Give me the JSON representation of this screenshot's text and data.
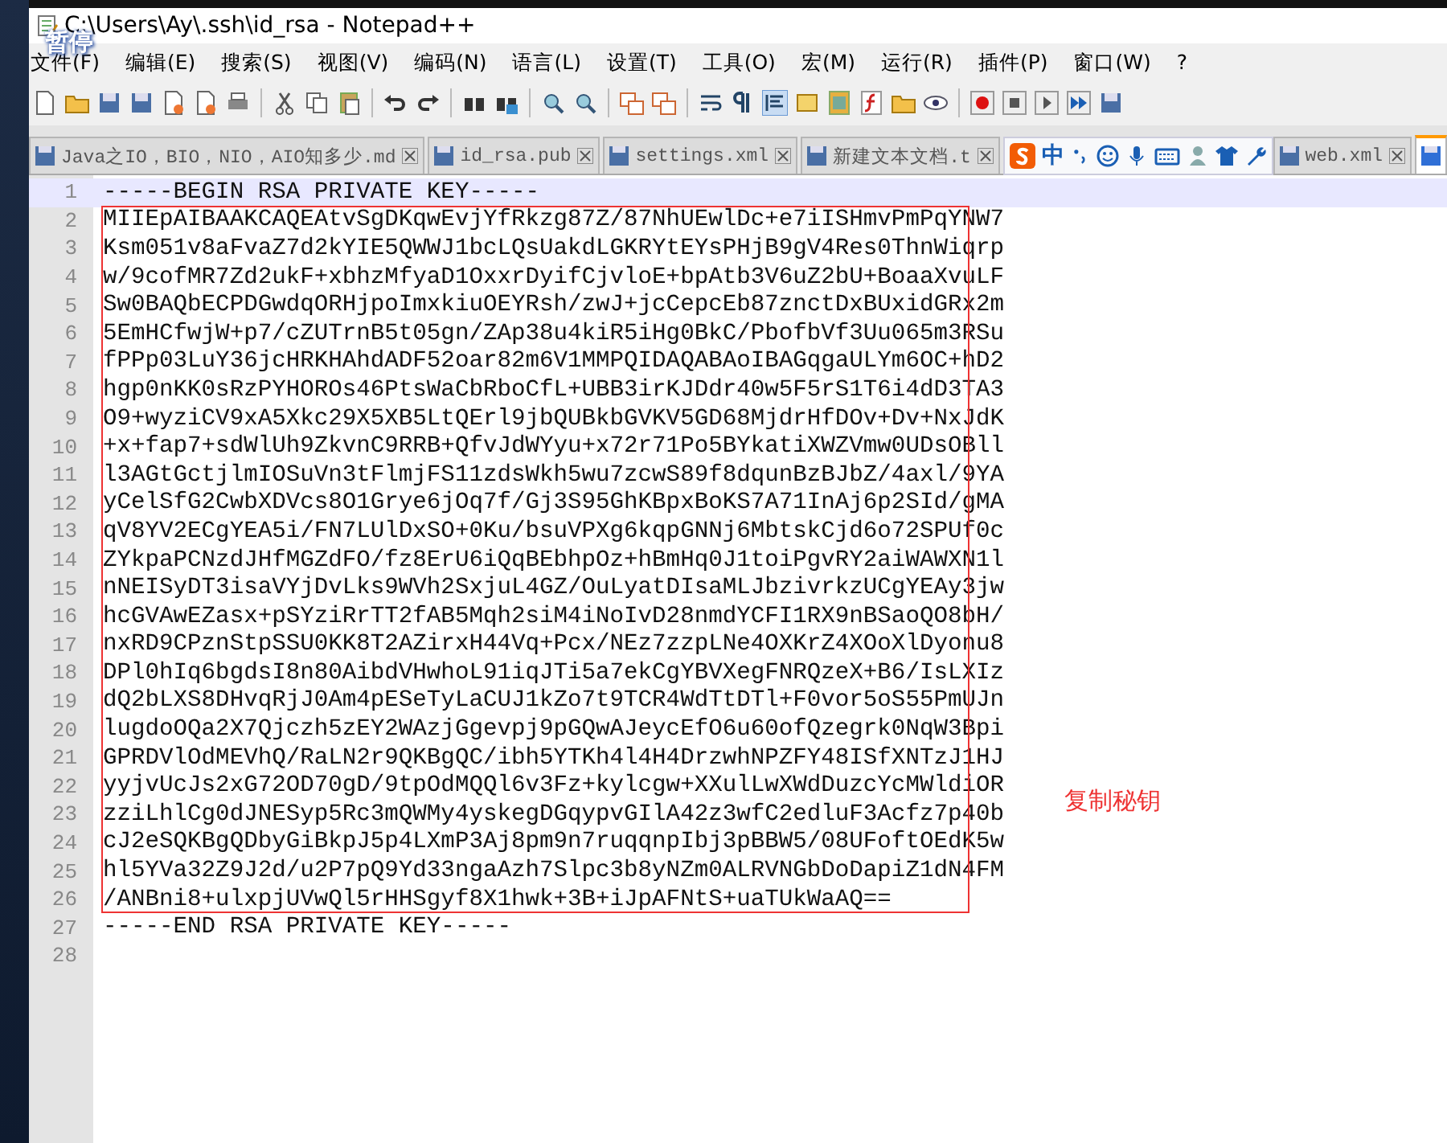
{
  "window": {
    "title": "C:\\Users\\Ay\\.ssh\\id_rsa - Notepad++"
  },
  "overlay_label": "暂停",
  "menu": [
    "文件(F)",
    "编辑(E)",
    "搜索(S)",
    "视图(V)",
    "编码(N)",
    "语言(L)",
    "设置(T)",
    "工具(O)",
    "宏(M)",
    "运行(R)",
    "插件(P)",
    "窗口(W)",
    "?"
  ],
  "tabs": [
    {
      "label": "Java之IO，BIO，NIO，AIO知多少.md",
      "selected": false
    },
    {
      "label": "id_rsa.pub",
      "selected": false
    },
    {
      "label": "settings.xml",
      "selected": false
    },
    {
      "label": "新建文本文档.t",
      "selected": false
    },
    {
      "label": "web.xml",
      "selected": false
    },
    {
      "selected": true
    }
  ],
  "ime_bar": {
    "label": "中"
  },
  "editor": {
    "lines": [
      {
        "number": "1",
        "text": "-----BEGIN RSA PRIVATE KEY-----",
        "current": true
      },
      {
        "number": "2",
        "text": "MIIEpAIBAAKCAQEAtvSgDKqwEvjYfRkzg87Z/87NhUEwlDc+e7iISHmvPmPqYNW7",
        "current": false
      },
      {
        "number": "3",
        "text": "Ksm051v8aFvaZ7d2kYIE5QWWJ1bcLQsUakdLGKRYtEYsPHjB9gV4Res0ThnWiqrp",
        "current": false
      },
      {
        "number": "4",
        "text": "w/9cofMR7Zd2ukF+xbhzMfyaD1OxxrDyifCjvloE+bpAtb3V6uZ2bU+BoaaXvuLF",
        "current": false
      },
      {
        "number": "5",
        "text": "Sw0BAQbECPDGwdqORHjpoImxkiuOEYRsh/zwJ+jcCepcEb87znctDxBUxidGRx2m",
        "current": false
      },
      {
        "number": "6",
        "text": "5EmHCfwjW+p7/cZUTrnB5t05gn/ZAp38u4kiR5iHg0BkC/PbofbVf3Uu065m3RSu",
        "current": false
      },
      {
        "number": "7",
        "text": "fPPp03LuY36jcHRKHAhdADF52oar82m6V1MMPQIDAQABAoIBAGqgaULYm6OC+hD2",
        "current": false
      },
      {
        "number": "8",
        "text": "hgp0nKK0sRzPYHOROs46PtsWaCbRboCfL+UBB3irKJDdr40w5F5rS1T6i4dD3TA3",
        "current": false
      },
      {
        "number": "9",
        "text": "O9+wyziCV9xA5Xkc29X5XB5LtQErl9jbQUBkbGVKV5GD68MjdrHfDOv+Dv+NxJdK",
        "current": false
      },
      {
        "number": "10",
        "text": "+x+fap7+sdWlUh9ZkvnC9RRB+QfvJdWYyu+x72r71Po5BYkatiXWZVmw0UDsOBll",
        "current": false
      },
      {
        "number": "11",
        "text": "l3AGtGctjlmIOSuVn3tFlmjFS11zdsWkh5wu7zcwS89f8dqunBzBJbZ/4axl/9YA",
        "current": false
      },
      {
        "number": "12",
        "text": "yCelSfG2CwbXDVcs8O1Grye6jOq7f/Gj3S95GhKBpxBoKS7A71InAj6p2SId/gMA",
        "current": false
      },
      {
        "number": "13",
        "text": "qV8YV2ECgYEA5i/FN7LUlDxSO+0Ku/bsuVPXg6kqpGNNj6MbtskCjd6o72SPUf0c",
        "current": false
      },
      {
        "number": "14",
        "text": "ZYkpaPCNzdJHfMGZdFO/fz8ErU6iQqBEbhpOz+hBmHq0J1toiPgvRY2aiWAWXN1l",
        "current": false
      },
      {
        "number": "15",
        "text": "nNEISyDT3isaVYjDvLks9WVh2SxjuL4GZ/OuLyatDIsaMLJbzivrkzUCgYEAy3jw",
        "current": false
      },
      {
        "number": "16",
        "text": "hcGVAwEZasx+pSYziRrTT2fAB5Mqh2siM4iNoIvD28nmdYCFI1RX9nBSaoQO8bH/",
        "current": false
      },
      {
        "number": "17",
        "text": "nxRD9CPznStpSSU0KK8T2AZirxH44Vq+Pcx/NEz7zzpLNe4OXKrZ4XOoXlDyonu8",
        "current": false
      },
      {
        "number": "18",
        "text": "DPl0hIq6bgdsI8n80AibdVHwhoL91iqJTi5a7ekCgYBVXegFNRQzeX+B6/IsLXIz",
        "current": false
      },
      {
        "number": "19",
        "text": "dQ2bLXS8DHvqRjJ0Am4pESeTyLaCUJ1kZo7t9TCR4WdTtDTl+F0vor5oS55PmUJn",
        "current": false
      },
      {
        "number": "20",
        "text": "lugdoOQa2X7Qjczh5zEY2WAzjGgevpj9pGQwAJeycEfO6u60ofQzegrk0NqW3Bpi",
        "current": false
      },
      {
        "number": "21",
        "text": "GPRDVlOdMEVhQ/RaLN2r9QKBgQC/ibh5YTKh4l4H4DrzwhNPZFY48ISfXNTzJ1HJ",
        "current": false
      },
      {
        "number": "22",
        "text": "yyjvUcJs2xG72OD70gD/9tpOdMQQl6v3Fz+kylcgw+XXulLwXWdDuzcYcMWldiOR",
        "current": false
      },
      {
        "number": "23",
        "text": "zziLhlCg0dJNESyp5Rc3mQWMy4yskegDGqypvGIlA42z3wfC2edluF3Acfz7p40b",
        "current": false
      },
      {
        "number": "24",
        "text": "cJ2eSQKBgQDbyGiBkpJ5p4LXmP3Aj8pm9n7ruqqnpIbj3pBBW5/08UFoftOEdK5w",
        "current": false
      },
      {
        "number": "25",
        "text": "hl5YVa32Z9J2d/u2P7pQ9Yd33ngaAzh7Slpc3b8yNZm0ALRVNGbDoDapiZ1dN4FM",
        "current": false
      },
      {
        "number": "26",
        "text": "/ANBni8+ulxpjUVwQl5rHHSgyf8X1hwk+3B+iJpAFNtS+uaTUkWaAQ==",
        "current": false
      },
      {
        "number": "27",
        "text": "-----END RSA PRIVATE KEY-----",
        "current": false
      },
      {
        "number": "28",
        "current": false
      }
    ]
  },
  "annotation": {
    "label": "复制秘钥"
  }
}
